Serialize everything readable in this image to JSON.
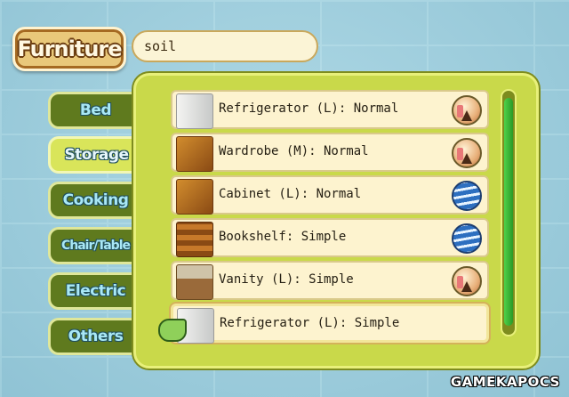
{
  "title": "Furniture",
  "name_field": {
    "value": "soil"
  },
  "categories": [
    {
      "label": "Bed",
      "selected": false
    },
    {
      "label": "Storage",
      "selected": true
    },
    {
      "label": "Cooking",
      "selected": false
    },
    {
      "label": "Chair/Table",
      "selected": false
    },
    {
      "label": "Electric",
      "selected": false
    },
    {
      "label": "Others",
      "selected": false
    }
  ],
  "items": [
    {
      "label": "Refrigerator (L): Normal",
      "thumb": "refrigerator-icon",
      "element": "earth-element-icon"
    },
    {
      "label": "Wardrobe (M): Normal",
      "thumb": "wardrobe-icon",
      "element": "earth-element-icon"
    },
    {
      "label": "Cabinet (L): Normal",
      "thumb": "cabinet-icon",
      "element": "water-element-icon"
    },
    {
      "label": "Bookshelf: Simple",
      "thumb": "bookshelf-icon",
      "element": "water-element-icon"
    },
    {
      "label": "Vanity (L): Simple",
      "thumb": "vanity-icon",
      "element": "earth-element-icon"
    },
    {
      "label": "Refrigerator (L): Simple",
      "thumb": "refrigerator-icon",
      "element": "",
      "highlighted": true
    }
  ],
  "watermark": "GAMEKAPOCS",
  "colors": {
    "panel": "#c9d94a",
    "row": "#fdf3cf",
    "tab": "#5f7a1e",
    "tab_selected": "#d9e55a",
    "scroll": "#2b9a26"
  }
}
